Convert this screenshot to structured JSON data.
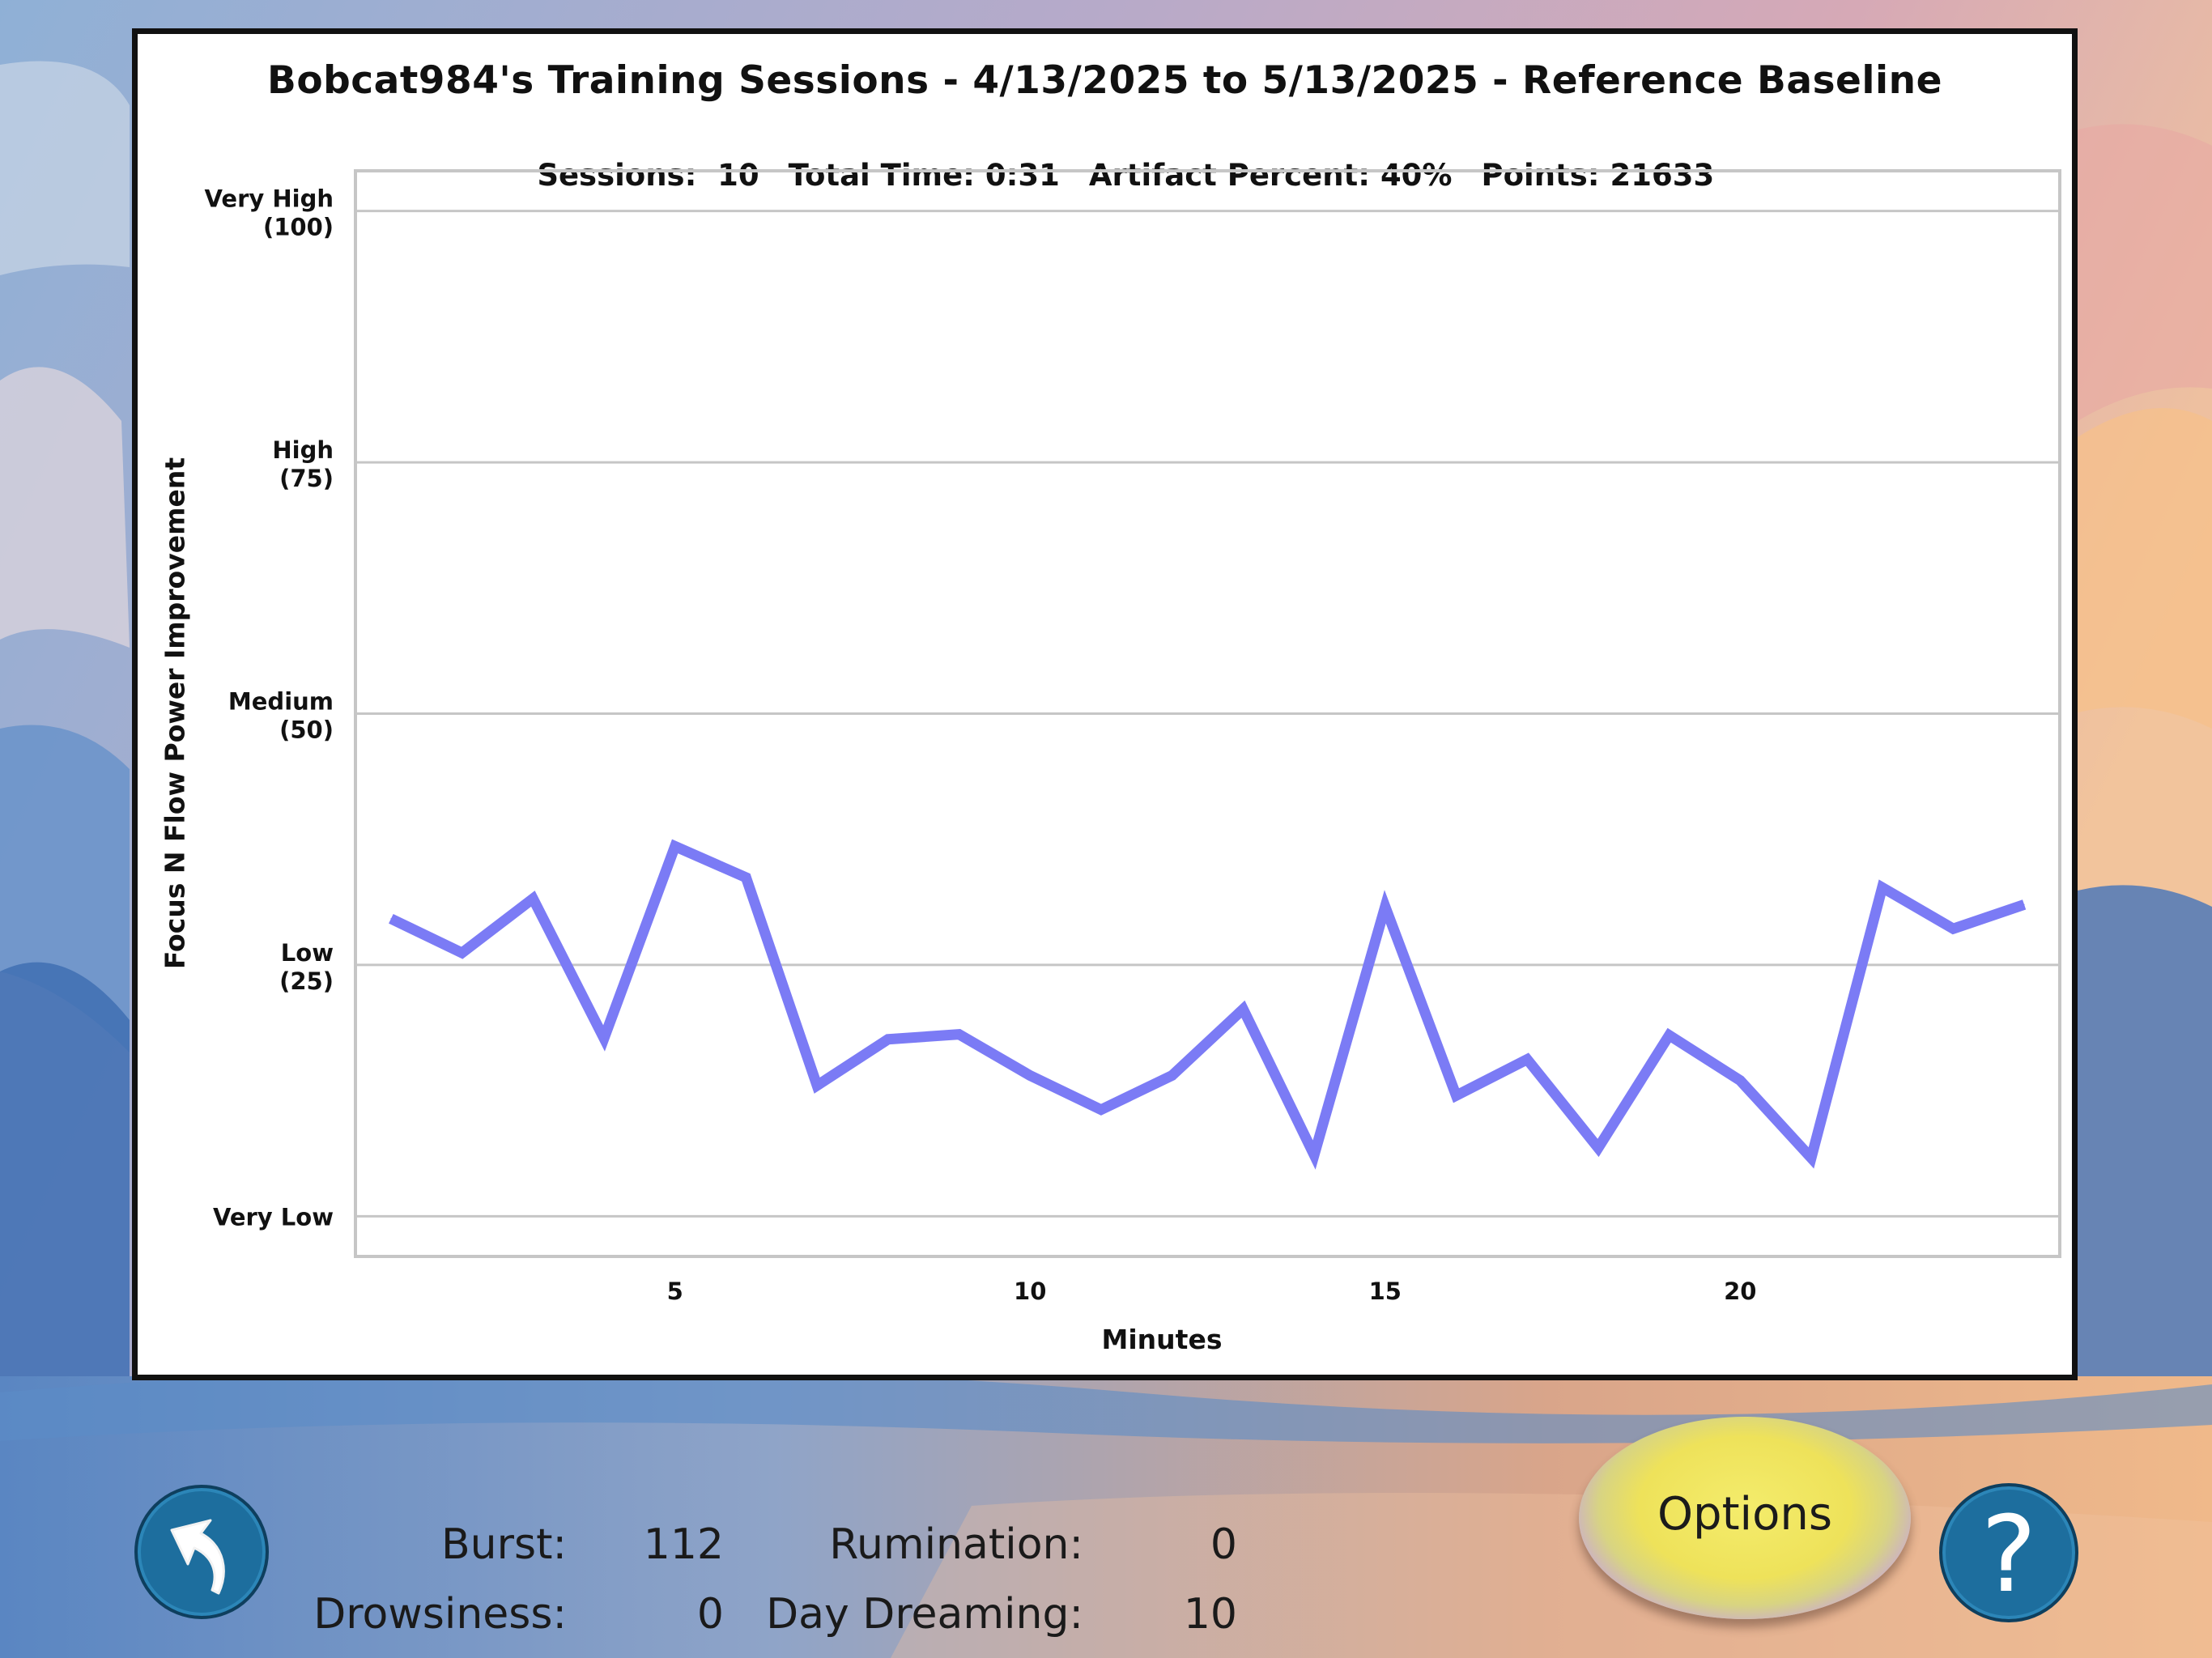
{
  "chart_data": {
    "type": "line",
    "title": "Bobcat984's Training Sessions - 4/13/2025 to 5/13/2025 - Reference Baseline",
    "summary": {
      "sessions_label": "Sessions:",
      "sessions_value": "10",
      "total_time_label": "Total Time:",
      "total_time_value": "0:31",
      "artifact_label": "Artifact Percent:",
      "artifact_value": "40%",
      "points_label": "Points:",
      "points_value": "21633"
    },
    "xlabel": "Minutes",
    "ylabel": "Focus N Flow Power Improvement",
    "xlim": [
      0.5,
      24.5
    ],
    "ylim": [
      -4,
      104
    ],
    "x_ticks": [
      5,
      10,
      15,
      20
    ],
    "y_ticks": [
      {
        "value": 100,
        "label": [
          "Very High",
          "(100)"
        ]
      },
      {
        "value": 75,
        "label": [
          "High",
          "(75)"
        ]
      },
      {
        "value": 50,
        "label": [
          "Medium",
          "(50)"
        ]
      },
      {
        "value": 25,
        "label": [
          "Low",
          "(25)"
        ]
      },
      {
        "value": 0,
        "label": [
          "Very Low"
        ]
      }
    ],
    "grid": true,
    "series": [
      {
        "color": "#7b7bf5",
        "x": [
          1,
          2,
          3,
          4,
          5,
          6,
          7,
          8,
          9,
          10,
          11,
          12,
          13,
          14,
          15,
          16,
          17,
          18,
          19,
          20,
          21,
          22,
          23,
          24
        ],
        "y": [
          29.6,
          26.2,
          31.6,
          17.7,
          36.8,
          33.7,
          13.0,
          17.6,
          18.1,
          14.0,
          10.6,
          14.0,
          20.6,
          6.1,
          30.8,
          12.0,
          15.6,
          6.8,
          18.0,
          13.5,
          5.8,
          32.7,
          28.6,
          31.0
        ]
      }
    ]
  },
  "stats": {
    "burst_label": "Burst:",
    "burst_value": "112",
    "rumination_label": "Rumination:",
    "rumination_value": "0",
    "drowsiness_label": "Drowsiness:",
    "drowsiness_value": "0",
    "daydreaming_label": "Day Dreaming:",
    "daydreaming_value": "10"
  },
  "buttons": {
    "options_label": "Options",
    "help_label": "?",
    "back_icon": "back-arrow-icon"
  }
}
